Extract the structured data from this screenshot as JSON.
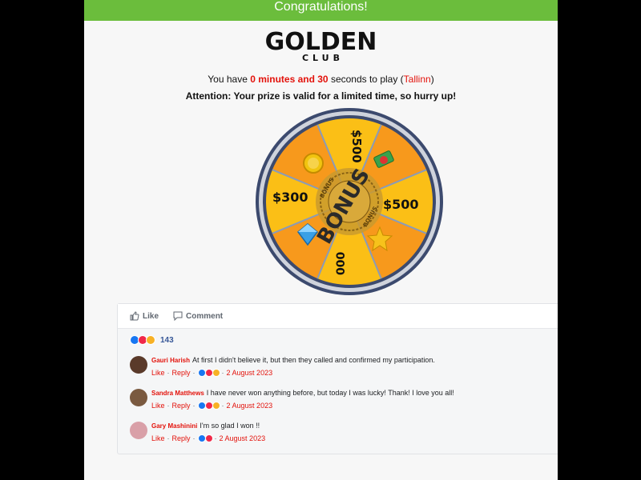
{
  "banner": {
    "title": "Congratulations!"
  },
  "logo": {
    "main": "GOLDEN",
    "sub": "CLUB"
  },
  "timer": {
    "prefix": "You have ",
    "time_value": "0 minutes and 30",
    "middle": " seconds to play (",
    "city": "Tallinn",
    "suffix": ")"
  },
  "attention": "Attention: Your prize is valid for a limited time, so hurry up!",
  "wheel": {
    "labels": [
      "$500",
      "$500",
      "$300",
      "000"
    ],
    "center_text": "BONUS",
    "center_small": "BONUS",
    "icons": [
      "coin-icon",
      "cash-icon",
      "diamond-icon",
      "star-icon"
    ]
  },
  "facebook": {
    "like_label": "Like",
    "comment_label": "Comment",
    "reaction_count": "143",
    "comments": [
      {
        "name": "Gauri Harish",
        "text": "At first I didn't believe it, but then they called and confirmed my participation.",
        "like": "Like",
        "reply": "Reply",
        "date": "2 August 2023",
        "avatar_color": "#5a3a2a"
      },
      {
        "name": "Sandra Matthews",
        "text": "I have never won anything before, but today I was lucky! Thank! I love you all!",
        "like": "Like",
        "reply": "Reply",
        "date": "2 August 2023",
        "avatar_color": "#7a5a40"
      },
      {
        "name": "Gary Mashinini",
        "text": "I'm so glad I won !!",
        "like": "Like",
        "reply": "Reply",
        "date": "2 August 2023",
        "avatar_color": "#d9a0a8"
      }
    ]
  }
}
